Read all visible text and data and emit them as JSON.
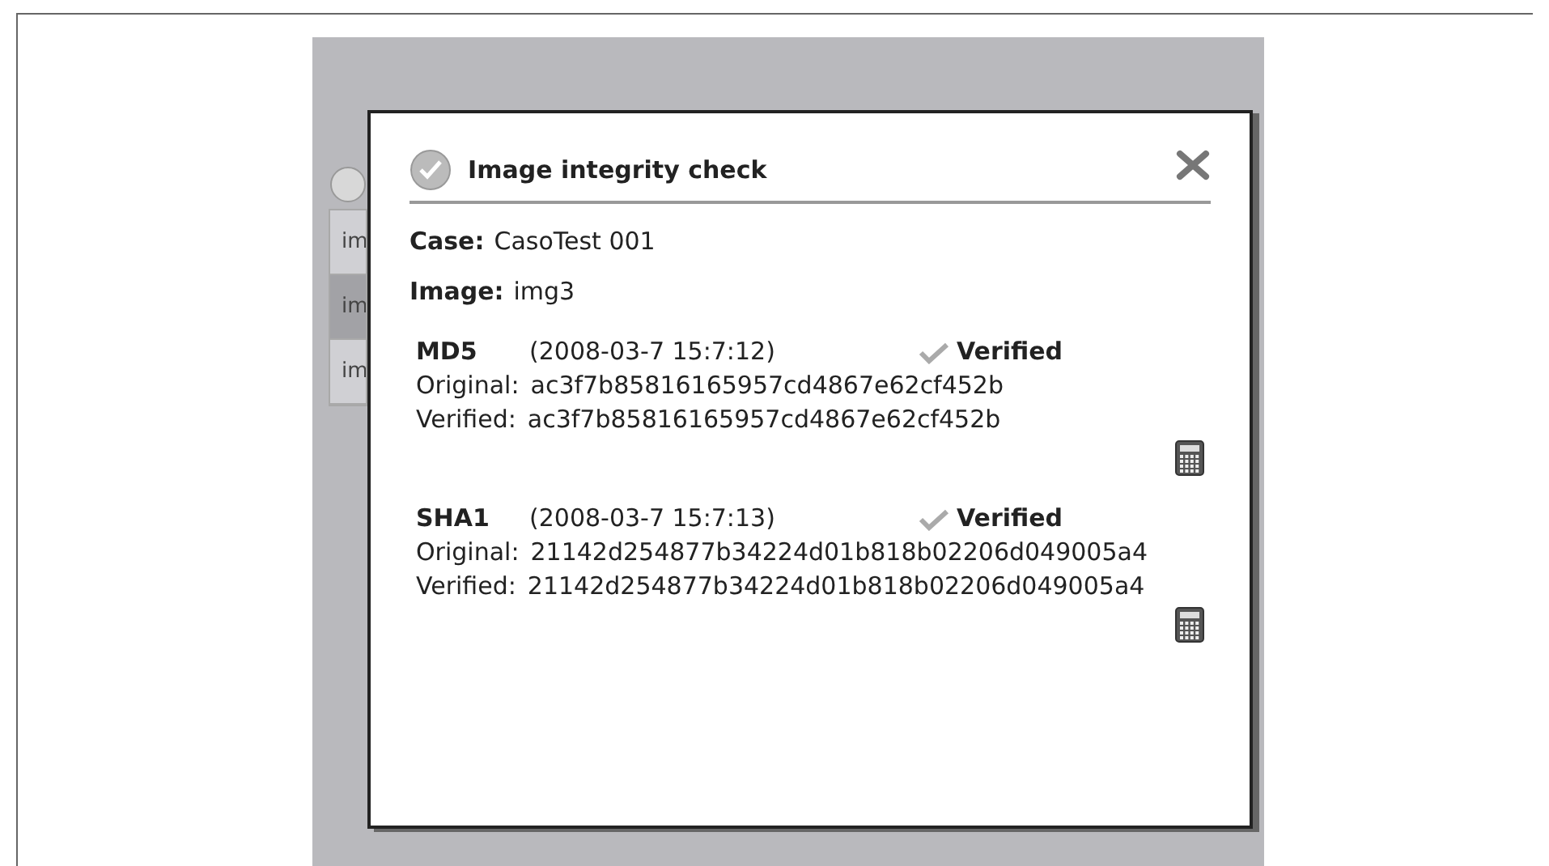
{
  "background_rows": [
    {
      "text": "im",
      "selected": false
    },
    {
      "text": "im",
      "selected": true
    },
    {
      "text": "im",
      "selected": false
    }
  ],
  "dialog": {
    "title": "Image integrity check",
    "fields": [
      {
        "label": "Case:",
        "value": "CasoTest 001"
      },
      {
        "label": "Image:",
        "value": "img3"
      }
    ],
    "hashes": [
      {
        "algorithm": "MD5",
        "timestamp": "(2008-03-7 15:7:12)",
        "verified": true,
        "status": "Verified",
        "original_label": "Original:",
        "original": "ac3f7b85816165957cd4867e62cf452b",
        "verified_label": "Verified:",
        "verified_hash": "ac3f7b85816165957cd4867e62cf452b"
      },
      {
        "algorithm": "SHA1",
        "timestamp": "(2008-03-7 15:7:13)",
        "verified": true,
        "status": "Verified",
        "original_label": "Original:",
        "original": "21142d254877b34224d01b818b02206d049005a4",
        "verified_label": "Verified:",
        "verified_hash": "21142d254877b34224d01b818b02206d049005a4"
      }
    ]
  }
}
